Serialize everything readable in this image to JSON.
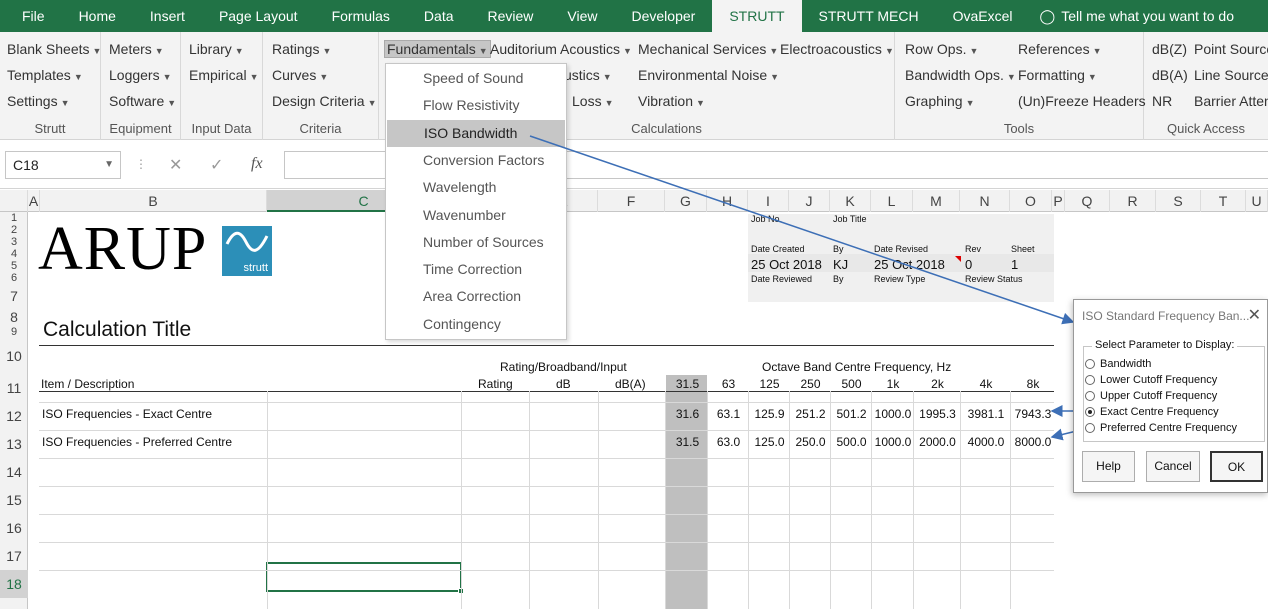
{
  "tabs": [
    "File",
    "Home",
    "Insert",
    "Page Layout",
    "Formulas",
    "Data",
    "Review",
    "View",
    "Developer",
    "STRUTT",
    "STRUTT MECH",
    "OvaExcel"
  ],
  "tell_me": "Tell me what you want to do",
  "ribbon": {
    "strutt": {
      "items": [
        "Blank Sheets",
        "Templates",
        "Settings"
      ],
      "label": "Strutt"
    },
    "equipment": {
      "items": [
        "Meters",
        "Loggers",
        "Software"
      ],
      "label": "Equipment"
    },
    "input_data": {
      "items": [
        "Library",
        "Empirical"
      ],
      "label": "Input Data"
    },
    "criteria": {
      "items": [
        "Ratings",
        "Curves",
        "Design Criteria"
      ],
      "label": "Criteria"
    },
    "calculations": {
      "items": [
        "Fundamentals",
        "Auditorium Acoustics",
        "Mechanical Services",
        "Electroacoustics",
        "ustics",
        "Environmental Noise",
        "Loss",
        "Vibration"
      ],
      "label": "Calculations"
    },
    "tools": {
      "items": [
        "Row Ops.",
        "Bandwidth Ops.",
        "Graphing",
        "References",
        "Formatting",
        "(Un)Freeze Headers"
      ],
      "label": "Tools"
    },
    "quick_access": {
      "items": [
        "dB(Z)",
        "dB(A)",
        "NR",
        "Point Source",
        "Line Source",
        "Barrier Atten"
      ],
      "label": "Quick Access"
    }
  },
  "namebox": "C18",
  "columns": [
    "A",
    "B",
    "C",
    "D",
    "E",
    "F",
    "G",
    "H",
    "I",
    "J",
    "K",
    "L",
    "M",
    "N",
    "O",
    "P",
    "Q",
    "R",
    "S",
    "T",
    "U"
  ],
  "rows": [
    "1",
    "2",
    "3",
    "4",
    "5",
    "6",
    "7",
    "8",
    "9",
    "10",
    "11",
    "12",
    "13",
    "14",
    "15",
    "16",
    "17",
    "18"
  ],
  "menu": [
    "Speed of Sound",
    "Flow Resistivity",
    "ISO Bandwidth",
    "Conversion Factors",
    "Wavelength",
    "Wavenumber",
    "Number of Sources",
    "Time Correction",
    "Area Correction",
    "Contingency"
  ],
  "logo": {
    "text": "ARUP",
    "badge": "strutt"
  },
  "header_block": {
    "job_no_label": "Job No.",
    "job_title_label": "Job Title",
    "date_created_label": "Date Created",
    "by_label": "By",
    "date_revised_label": "Date Revised",
    "rev_label": "Rev",
    "sheet_label": "Sheet",
    "date_created": "25 Oct 2018",
    "by": "KJ",
    "date_revised": "25 Oct 2018",
    "rev": "0",
    "sheet": "1",
    "date_reviewed_label": "Date Reviewed",
    "by2_label": "By",
    "review_type_label": "Review Type",
    "review_status_label": "Review Status"
  },
  "calc_title": "Calculation Title",
  "table": {
    "group_header_1": "Rating/Broadband/Input",
    "group_header_2": "Octave Band Centre Frequency, Hz",
    "item_header": "Item / Description",
    "col_headers": [
      "Rating",
      "dB",
      "dB(A)"
    ],
    "bands": [
      "31.5",
      "63",
      "125",
      "250",
      "500",
      "1k",
      "2k",
      "4k",
      "8k"
    ],
    "rows": [
      {
        "label": "ISO Frequencies - Exact Centre",
        "values": [
          "31.6",
          "63.1",
          "125.9",
          "251.2",
          "501.2",
          "1000.0",
          "1995.3",
          "3981.1",
          "7943.3"
        ]
      },
      {
        "label": "ISO Frequencies - Preferred Centre",
        "values": [
          "31.5",
          "63.0",
          "125.0",
          "250.0",
          "500.0",
          "1000.0",
          "2000.0",
          "4000.0",
          "8000.0"
        ]
      }
    ]
  },
  "dialog": {
    "title": "ISO Standard Frequency Ban...",
    "legend": "Select Parameter to Display:",
    "options": [
      "Bandwidth",
      "Lower Cutoff Frequency",
      "Upper Cutoff Frequency",
      "Exact Centre Frequency",
      "Preferred Centre Frequency"
    ],
    "selected_index": 3,
    "buttons": {
      "help": "Help",
      "cancel": "Cancel",
      "ok": "OK"
    }
  },
  "colors": {
    "excel_green": "#217346",
    "strutt_teal": "#2c8fb8",
    "arrow_blue": "#3d6fb6",
    "band_grey": "#bfbfbf"
  }
}
